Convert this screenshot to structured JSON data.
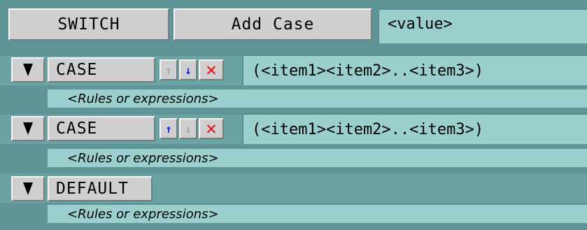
{
  "toolbar": {
    "switch_label": "SWITCH",
    "add_case_label": "Add Case",
    "value_text": "<value>"
  },
  "cases": [
    {
      "label": "CASE",
      "up_arrow": "↑",
      "down_arrow": "↓",
      "delete_glyph": "✕",
      "expression": "(<item1><item2>..<item3>)",
      "rules_text": "<Rules or expressions>"
    },
    {
      "label": "CASE",
      "up_arrow": "↑",
      "down_arrow": "↓",
      "delete_glyph": "✕",
      "expression": "(<item1><item2>..<item3>)",
      "rules_text": "<Rules or expressions>"
    }
  ],
  "default_case": {
    "label": "DEFAULT",
    "rules_text": "<Rules or expressions>"
  },
  "icons": {
    "toggle": "collapse-triangle-icon",
    "up": "move-up-icon",
    "down": "move-down-icon",
    "delete": "delete-x-icon"
  },
  "colors": {
    "background": "#5f9596",
    "field": "#9acfcd",
    "button": "#cfcfcf",
    "up_down_active": "#1020e6",
    "up_down_disabled": "#a6a6a6",
    "delete": "#ee1111"
  }
}
